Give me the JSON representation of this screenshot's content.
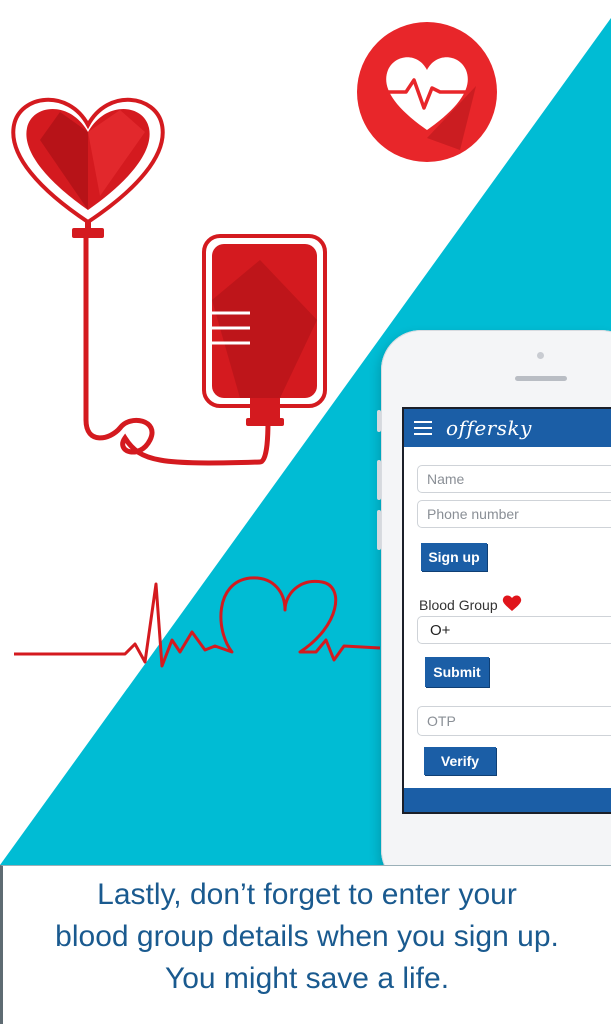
{
  "app": {
    "brand": "offersky"
  },
  "form": {
    "name_placeholder": "Name",
    "phone_placeholder": "Phone number",
    "signup_label": "Sign up",
    "blood_group_label": "Blood Group",
    "blood_group_value": "O+",
    "submit_label": "Submit",
    "otp_placeholder": "OTP",
    "verify_label": "Verify"
  },
  "caption": {
    "line1": "Lastly, don’t forget to enter your",
    "line2": "blood group details when you sign up.",
    "line3": "You might save a life."
  },
  "colors": {
    "accent_blue": "#1b5ea6",
    "cyan": "#00bcd4",
    "red": "#e0151b",
    "caption_text": "#1a5a8f"
  },
  "icons": [
    "heart-pulse-icon",
    "heart-blood-bag-icon",
    "heartbeat-line-icon",
    "menu-icon",
    "heart-icon"
  ]
}
